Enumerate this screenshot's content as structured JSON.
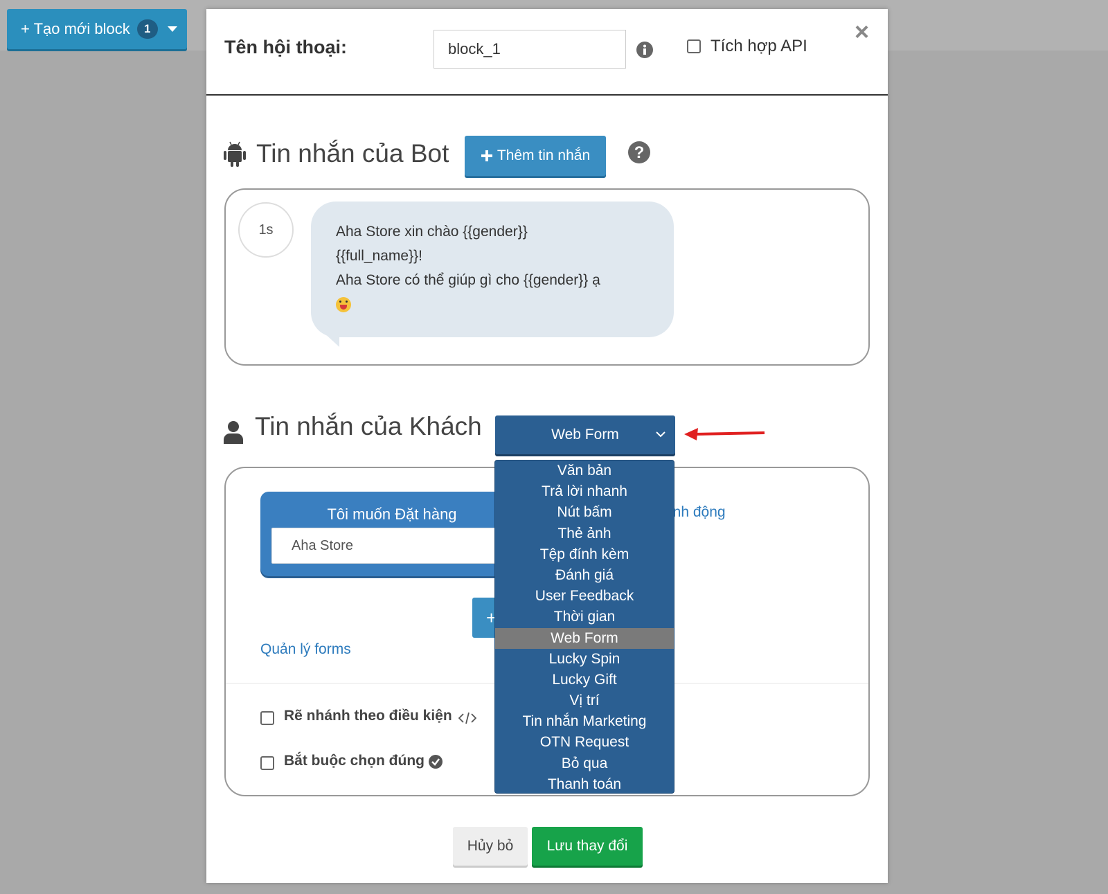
{
  "topbar": {
    "create_block_label": "+ Tạo mới block",
    "create_block_count": "1"
  },
  "modal": {
    "title_label": "Tên hội thoại:",
    "name_value": "block_1",
    "api_label": "Tích hợp API",
    "api_checked": false,
    "close_label": "×"
  },
  "bot": {
    "section_title": "Tin nhắn của Bot",
    "add_button": "Thêm tin nhắn",
    "delay": "1s",
    "message_lines": [
      "Aha Store xin chào {{gender}}",
      "{{full_name}}!",
      "Aha Store có thể giúp gì cho {{gender}} ạ"
    ]
  },
  "customer": {
    "section_title": "Tin nhắn của Khách",
    "selected_type": "Web Form",
    "card_title": "Tôi muốn Đặt hàng",
    "card_input_value": "Aha Store",
    "action_link_fragment": "ành động",
    "manage_forms_link": "Quản lý forms",
    "branch_label": "Rẽ nhánh theo điều kiện",
    "required_label": "Bắt buộc chọn đúng"
  },
  "dropdown": {
    "options": [
      "Văn bản",
      "Trả lời nhanh",
      "Nút bấm",
      "Thẻ ảnh",
      "Tệp đính kèm",
      "Đánh giá",
      "User Feedback",
      "Thời gian",
      "Web Form",
      "Lucky Spin",
      "Lucky Gift",
      "Vị trí",
      "Tin nhắn Marketing",
      "OTN Request",
      "Bỏ qua",
      "Thanh toán"
    ],
    "selected": "Web Form"
  },
  "footer": {
    "cancel_label": "Hủy bỏ",
    "save_label": "Lưu thay đổi"
  },
  "colors": {
    "primary_blue": "#2b8fbd",
    "select_navy": "#2b5f92",
    "save_green": "#17a34a",
    "link_blue": "#2d7bbd",
    "annotation_red": "#e02020"
  }
}
